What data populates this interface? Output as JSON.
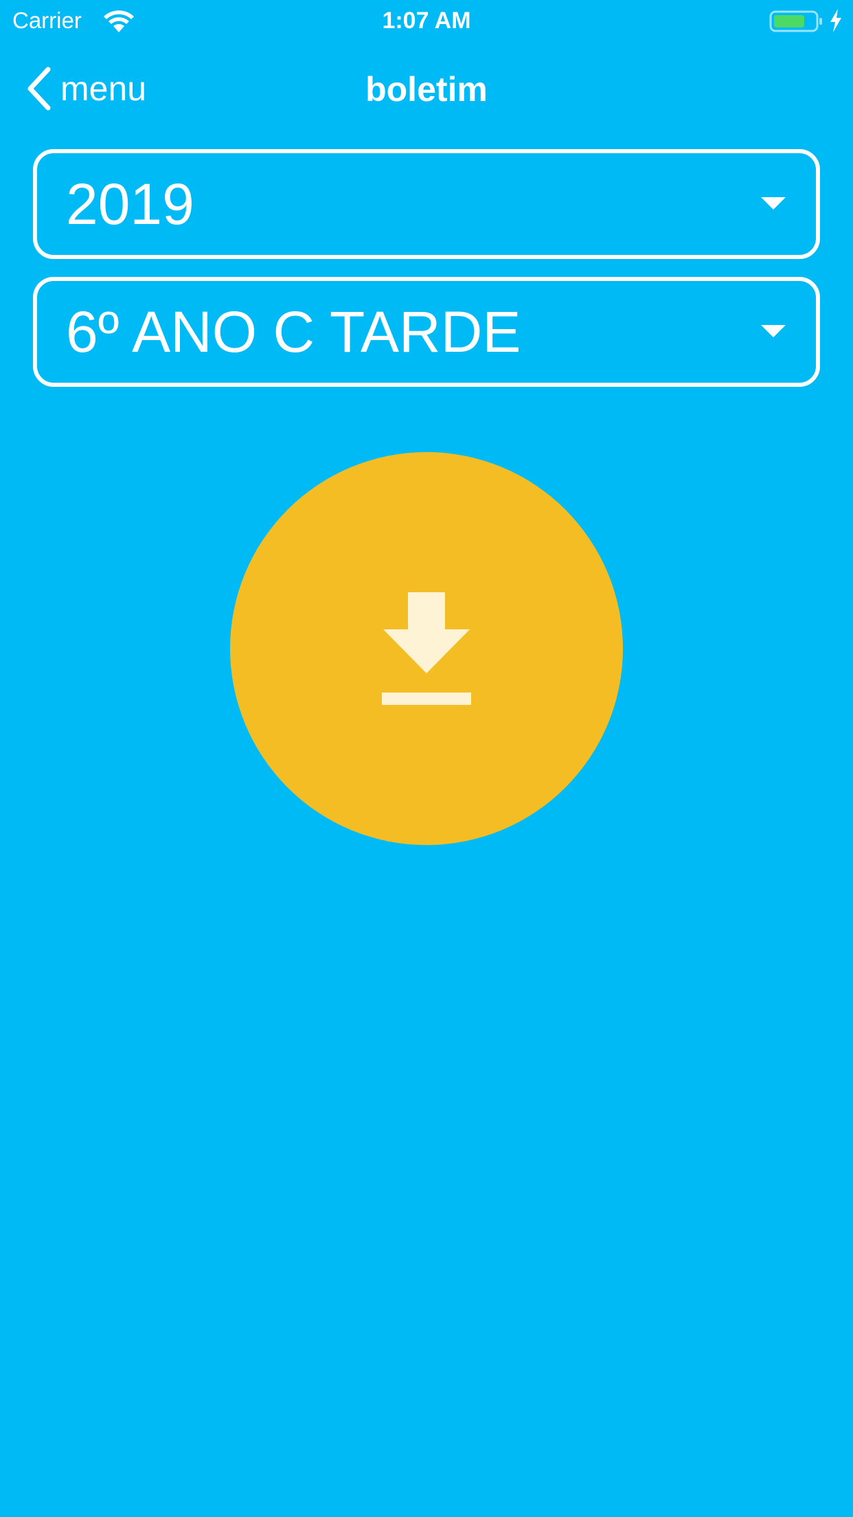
{
  "status_bar": {
    "carrier": "Carrier",
    "time": "1:07 AM",
    "battery_color": "#4CD964"
  },
  "nav": {
    "back_label": "menu",
    "title": "boletim"
  },
  "filters": {
    "year": {
      "selected": "2019"
    },
    "class": {
      "selected": "6º ANO C TARDE"
    }
  },
  "download": {
    "icon": "download-icon",
    "button_color": "#F4BD24",
    "icon_color": "#FFF3D6"
  },
  "colors": {
    "background": "#00BAF6",
    "foreground": "#FFFFFF"
  }
}
